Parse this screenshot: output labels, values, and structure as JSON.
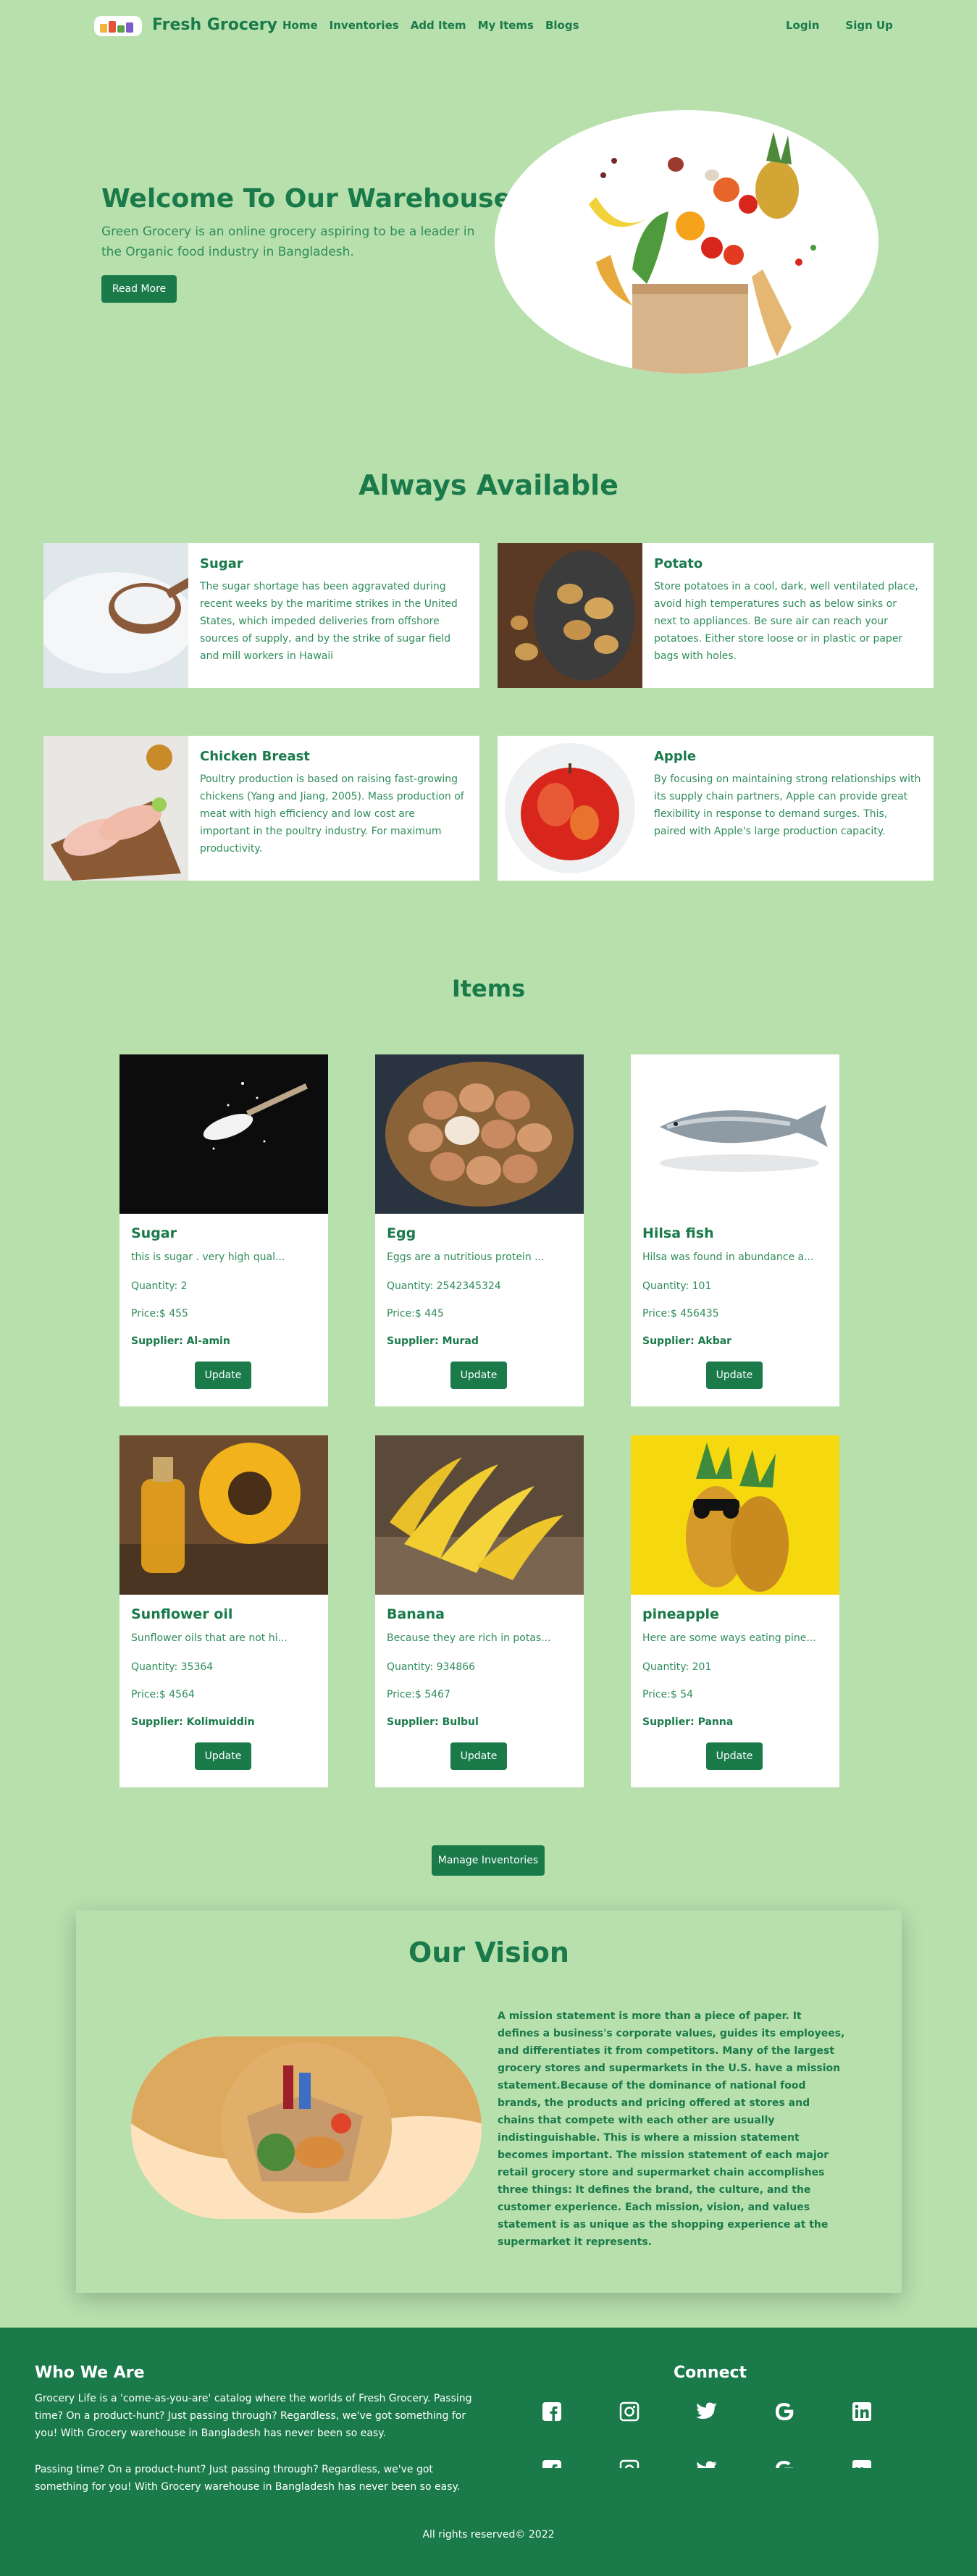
{
  "nav": {
    "brand": "Fresh Grocery",
    "links": [
      "Home",
      "Inventories",
      "Add Item",
      "My Items",
      "Blogs"
    ],
    "login": "Login",
    "signup": "Sign Up"
  },
  "hero": {
    "title": "Welcome To Our Warehouse",
    "subtitle": "Green Grocery is an online grocery aspiring to be a leader in the Organic food industry in Bangladesh.",
    "button": "Read More"
  },
  "always_available": {
    "title": "Always Available",
    "cards": [
      {
        "name": "Sugar",
        "desc": "The sugar shortage has been aggravated during recent weeks by the maritime strikes in the United States, which impeded deliveries from offshore sources of supply, and by the strike of sugar field and mill workers in Hawaii"
      },
      {
        "name": "Potato",
        "desc": "Store potatoes in a cool, dark, well ventilated place, avoid high temperatures such as below sinks or next to appliances. Be sure air can reach your potatoes. Either store loose or in plastic or paper bags with holes."
      },
      {
        "name": "Chicken Breast",
        "desc": "Poultry production is based on raising fast-growing chickens (Yang and Jiang, 2005). Mass production of meat with high efficiency and low cost are important in the poultry industry. For maximum productivity."
      },
      {
        "name": "Apple",
        "desc": "By focusing on maintaining strong relationships with its supply chain partners, Apple can provide great flexibility in response to demand surges. This, paired with Apple's large production capacity."
      }
    ]
  },
  "items": {
    "title": "Items",
    "update_label": "Update",
    "list": [
      {
        "name": "Sugar",
        "desc": "this is sugar . very high qual...",
        "quantity": "Quantity: 2",
        "price": "Price:$ 455",
        "supplier": "Supplier: Al-amin"
      },
      {
        "name": "Egg",
        "desc": "Eggs are a nutritious protein ...",
        "quantity": "Quantity: 2542345324",
        "price": "Price:$ 445",
        "supplier": "Supplier: Murad"
      },
      {
        "name": "Hilsa fish",
        "desc": "Hilsa was found in abundance a...",
        "quantity": "Quantity: 101",
        "price": "Price:$ 456435",
        "supplier": "Supplier: Akbar"
      },
      {
        "name": "Sunflower oil",
        "desc": "Sunflower oils that are not hi...",
        "quantity": "Quantity: 35364",
        "price": "Price:$ 4564",
        "supplier": "Supplier: Kolimuiddin"
      },
      {
        "name": "Banana",
        "desc": "Because they are rich in potas...",
        "quantity": "Quantity: 934866",
        "price": "Price:$ 5467",
        "supplier": "Supplier: Bulbul"
      },
      {
        "name": "pineapple",
        "desc": "Here are some ways eating pine...",
        "quantity": "Quantity: 201",
        "price": "Price:$ 54",
        "supplier": "Supplier: Panna"
      }
    ],
    "manage_button": "Manage Inventories"
  },
  "vision": {
    "title": "Our Vision",
    "text": "A mission statement is more than a piece of paper. It defines a business's corporate values, guides its employees, and differentiates it from competitors. Many of the largest grocery stores and supermarkets in the U.S. have a mission statement.Because of the dominance of national food brands, the products and pricing offered at stores and chains that compete with each other are usually indistinguishable. This is where a mission statement becomes important. The mission statement of each major retail grocery store and supermarket chain accomplishes three things: It defines the brand, the culture, and the customer experience. Each mission, vision, and values statement is as unique as the shopping experience at the supermarket it represents."
  },
  "footer": {
    "who_title": "Who We Are",
    "who_text": "Grocery Life is a 'come-as-you-are' catalog where the worlds of Fresh Grocery. Passing time? On a product-hunt? Just passing through? Regardless, we've got something for you! With Grocery warehouse in Bangladesh has never been so easy.",
    "who_text_repeat": "Passing time? On a product-hunt? Just passing through? Regardless, we've got something for you! With Grocery warehouse in Bangladesh has never been so easy.",
    "connect_title": "Connect",
    "icons": [
      "facebook-icon",
      "instagram-icon",
      "twitter-icon",
      "google-icon",
      "linkedin-icon"
    ],
    "copyright": "All rights reserved© 2022"
  },
  "colors": {
    "background": "#b7e0ad",
    "accent": "#1a7a4a",
    "card": "#ffffff"
  }
}
